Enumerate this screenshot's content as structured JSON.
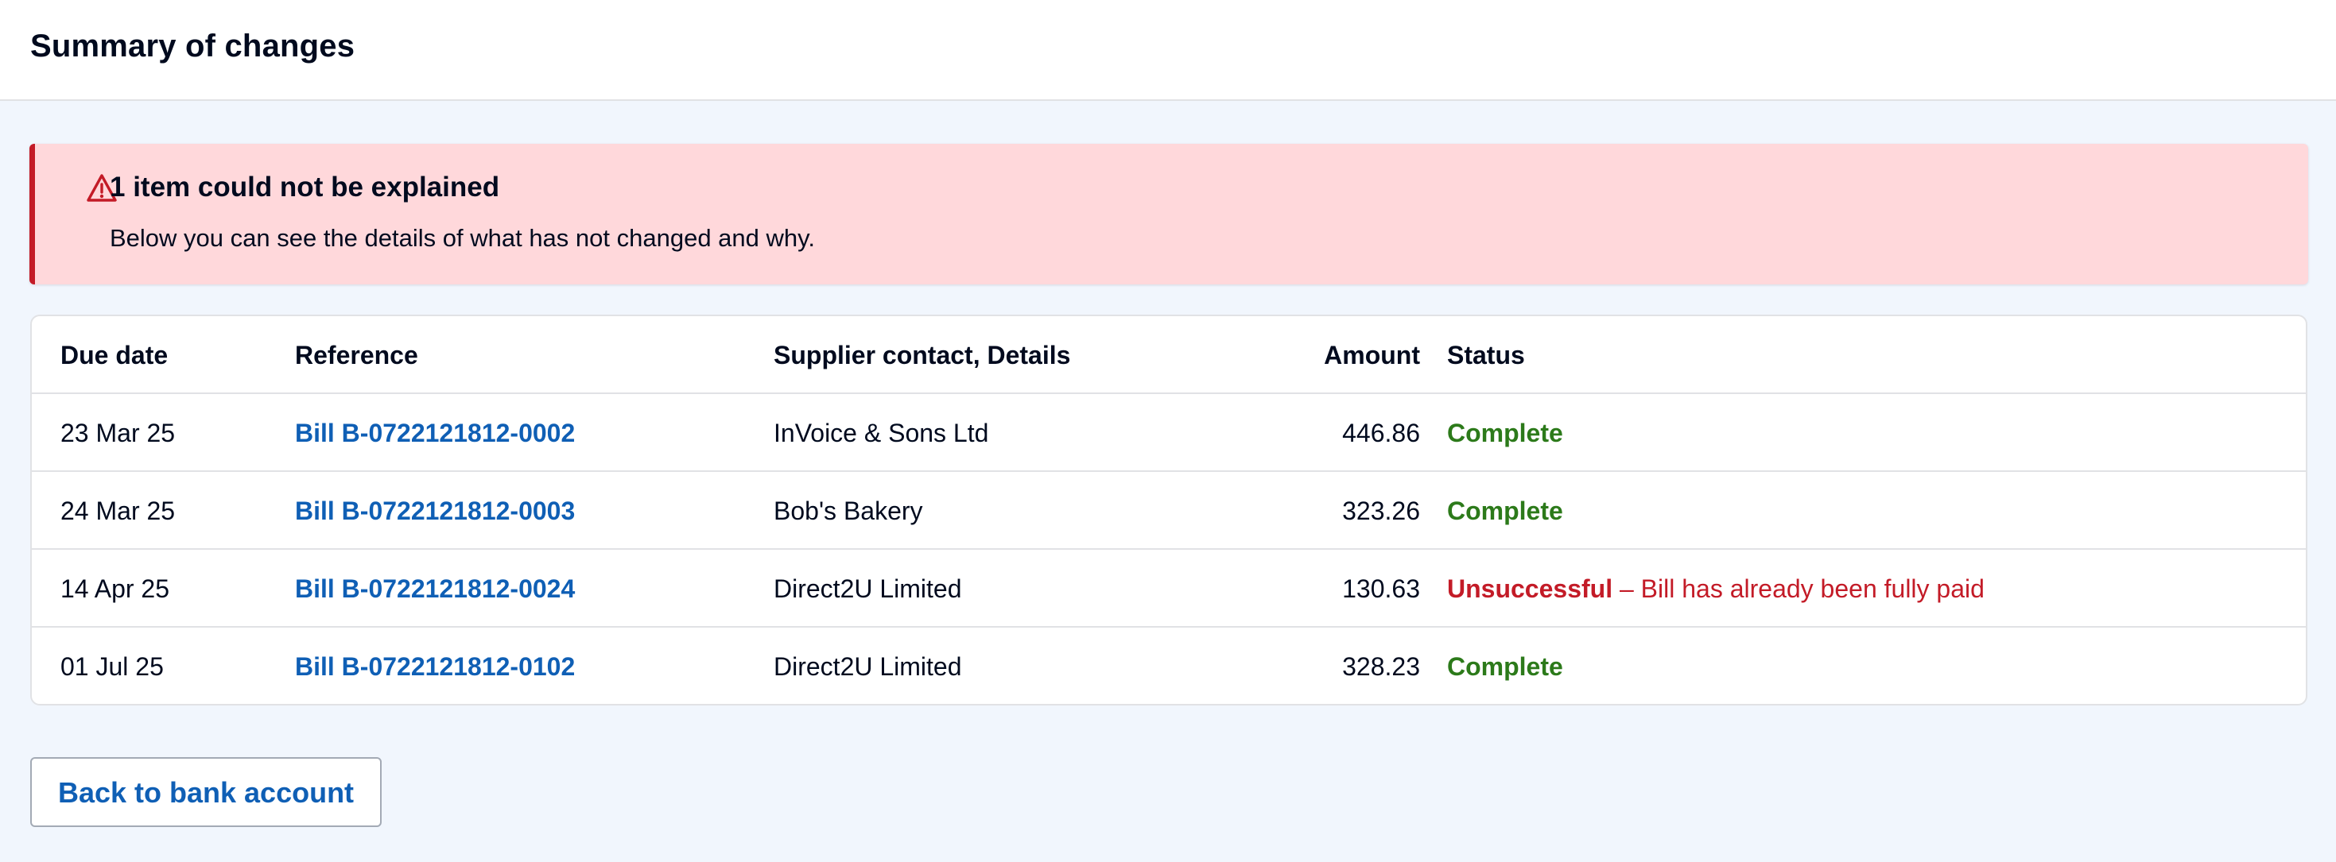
{
  "header": {
    "title": "Summary of changes"
  },
  "alert": {
    "icon": "warning-triangle-icon",
    "title": "1 item could not be explained",
    "message": "Below you can see the details of what has not changed and why.",
    "color": "#c31b27",
    "background": "#ffd8db"
  },
  "table": {
    "columns": {
      "due_date": "Due date",
      "reference": "Reference",
      "supplier": "Supplier contact, Details",
      "amount": "Amount",
      "status": "Status"
    },
    "rows": [
      {
        "due_date": "23 Mar 25",
        "reference": "Bill B-0722121812-0002",
        "supplier": "InVoice & Sons Ltd",
        "amount": "446.86",
        "status": "Complete",
        "status_detail": ""
      },
      {
        "due_date": "24 Mar 25",
        "reference": "Bill B-0722121812-0003",
        "supplier": "Bob's Bakery",
        "amount": "323.26",
        "status": "Complete",
        "status_detail": ""
      },
      {
        "due_date": "14 Apr 25",
        "reference": "Bill B-0722121812-0024",
        "supplier": "Direct2U Limited",
        "amount": "130.63",
        "status": "Unsuccessful",
        "status_detail": " – Bill has already been fully paid"
      },
      {
        "due_date": "01 Jul 25",
        "reference": "Bill B-0722121812-0102",
        "supplier": "Direct2U Limited",
        "amount": "328.23",
        "status": "Complete",
        "status_detail": ""
      }
    ]
  },
  "actions": {
    "back_label": "Back to bank account"
  },
  "colors": {
    "link": "#0f5fb5",
    "success": "#2c7a1a",
    "error": "#c31b27",
    "page_background": "#f1f6fd"
  }
}
